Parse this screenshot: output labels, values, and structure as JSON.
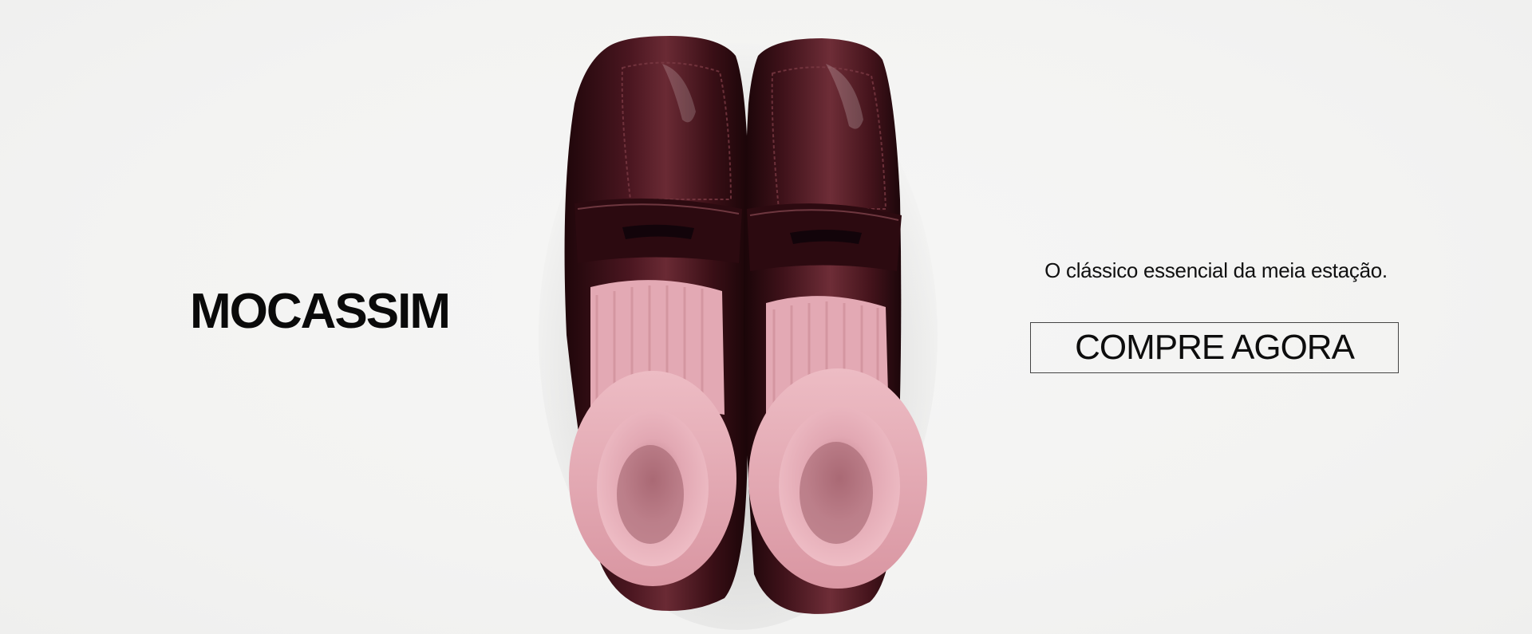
{
  "banner": {
    "title": "MOCASSIM",
    "tagline": "O clássico essencial da meia estação.",
    "cta_label": "COMPRE AGORA"
  },
  "product_image": {
    "alt": "loafers-with-pink-socks"
  },
  "colors": {
    "background": "#f4f4f3",
    "leather": "#3a0f16",
    "sock": "#e6aab5",
    "text": "#0a0a0a"
  }
}
